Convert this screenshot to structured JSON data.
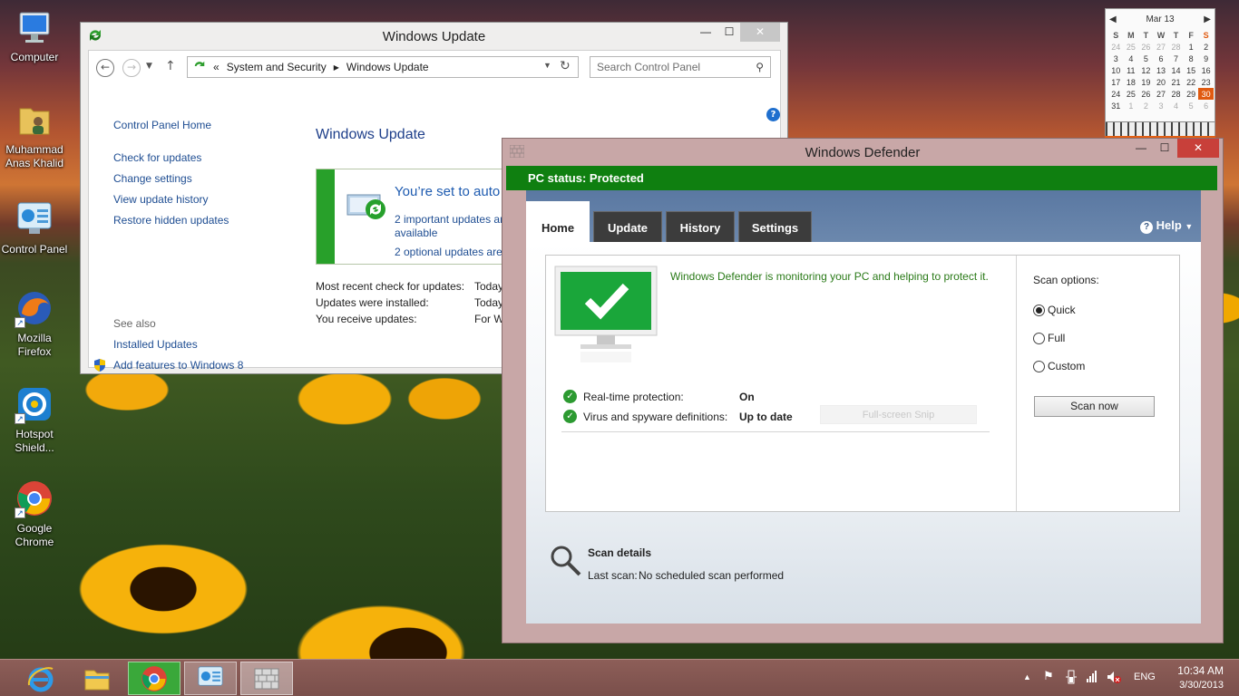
{
  "desktop": {
    "icons": [
      {
        "label": "Computer"
      },
      {
        "label": "Muhammad Anas Khalid"
      },
      {
        "label": "Control Panel"
      },
      {
        "label": "Mozilla Firefox"
      },
      {
        "label": "Hotspot Shield..."
      },
      {
        "label": "Google Chrome"
      }
    ]
  },
  "calendar": {
    "month": "Mar 13",
    "weekdays": [
      "S",
      "M",
      "T",
      "W",
      "T",
      "F",
      "S"
    ],
    "weeks": [
      [
        "24",
        "25",
        "26",
        "27",
        "28",
        "1",
        "2"
      ],
      [
        "3",
        "4",
        "5",
        "6",
        "7",
        "8",
        "9"
      ],
      [
        "10",
        "11",
        "12",
        "13",
        "14",
        "15",
        "16"
      ],
      [
        "17",
        "18",
        "19",
        "20",
        "21",
        "22",
        "23"
      ],
      [
        "24",
        "25",
        "26",
        "27",
        "28",
        "29",
        "30"
      ],
      [
        "31",
        "1",
        "2",
        "3",
        "4",
        "5",
        "6"
      ]
    ],
    "today": "30",
    "accent": "#e05a10"
  },
  "windows_update": {
    "title": "Windows Update",
    "breadcrumb": {
      "sep": "«",
      "parent": "System and Security",
      "current": "Windows Update"
    },
    "search_placeholder": "Search Control Panel",
    "sidebar": {
      "home": "Control Panel Home",
      "links": [
        "Check for updates",
        "Change settings",
        "View update history",
        "Restore hidden updates"
      ],
      "see_also_heading": "See also",
      "see_also": [
        "Installed Updates",
        "Add features to Windows 8"
      ]
    },
    "heading": "Windows Update",
    "status": {
      "title": "You’re set to auto",
      "important": "2 important updates ar",
      "important_cont": "available",
      "optional": "2 optional updates are"
    },
    "details": [
      {
        "label": "Most recent check for updates:",
        "value": "Today"
      },
      {
        "label": "Updates were installed:",
        "value": "Today"
      },
      {
        "label": "You receive updates:",
        "value": "For W"
      }
    ]
  },
  "defender": {
    "title": "Windows Defender",
    "status_text": "PC status: Protected",
    "status_color": "#0f7f10",
    "tabs": [
      "Home",
      "Update",
      "History",
      "Settings"
    ],
    "help": "Help",
    "monitor_text": "Windows Defender is monitoring your PC and helping to protect it.",
    "rows": [
      {
        "label": "Real-time protection:",
        "value": "On"
      },
      {
        "label": "Virus and spyware definitions:",
        "value": "Up to date"
      }
    ],
    "snip_ghost": "Full-screen Snip",
    "scan_options_label": "Scan options:",
    "options": [
      "Quick",
      "Full",
      "Custom"
    ],
    "selected_option": "Quick",
    "scan_button": "Scan now",
    "scan_details_title": "Scan details",
    "last_scan_label": "Last scan:",
    "last_scan_value": "No scheduled scan performed"
  },
  "taskbar": {
    "apps": [
      "internet-explorer",
      "file-explorer",
      "google-chrome",
      "control-panel",
      "windows-defender"
    ],
    "language": "ENG",
    "time": "10:34 AM",
    "date": "3/30/2013"
  }
}
